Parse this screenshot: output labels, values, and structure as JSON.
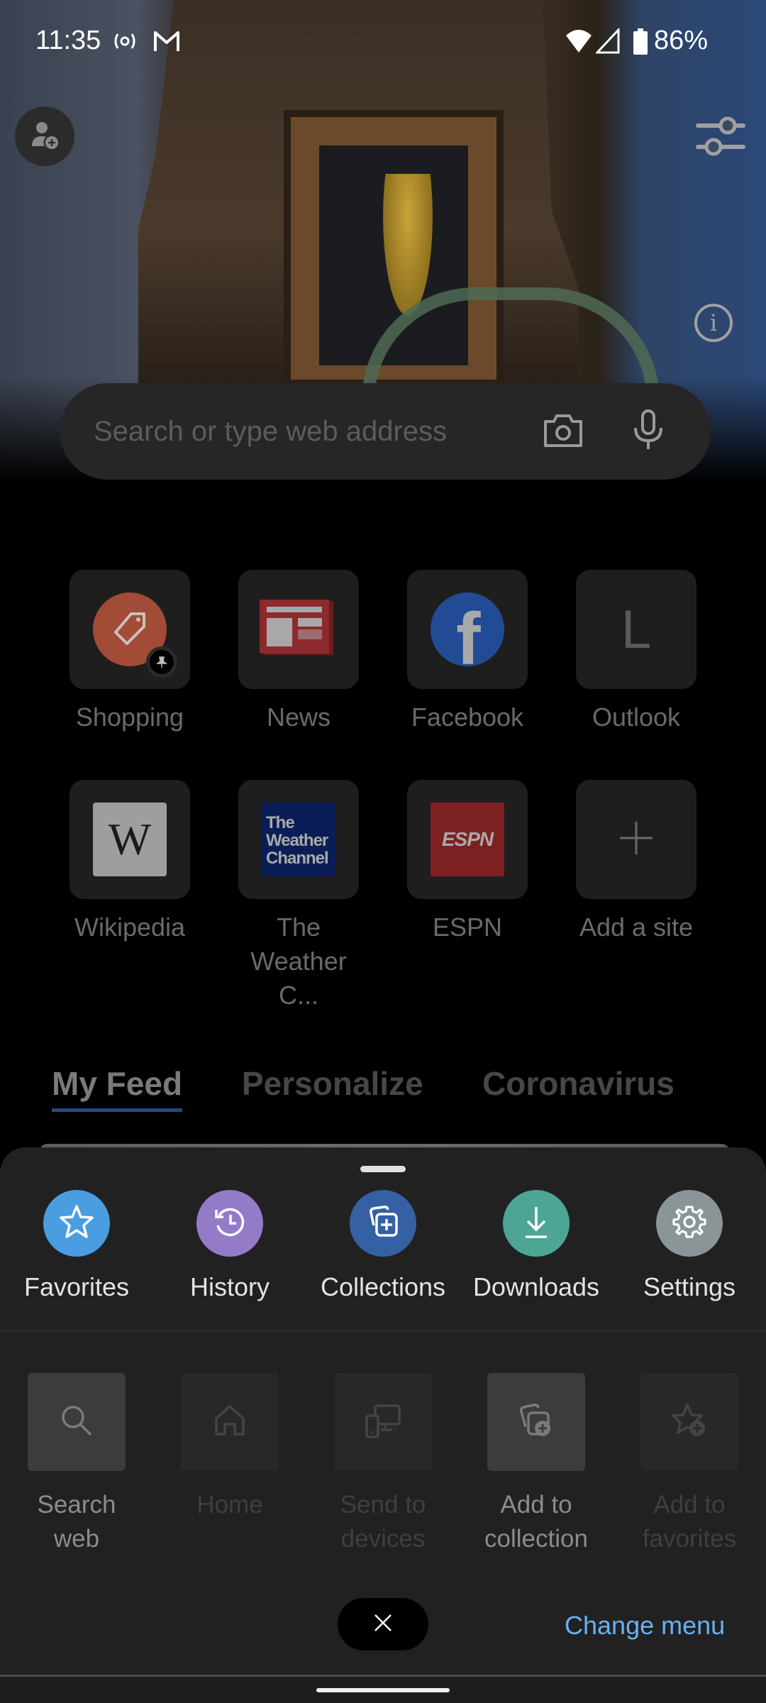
{
  "status_bar": {
    "time": "11:35",
    "icons": [
      "hotspot-icon",
      "gmail-icon",
      "wifi-icon",
      "cellular-signal-icon",
      "battery-icon"
    ],
    "battery": "86%"
  },
  "header": {
    "profile_icon": "add-profile-icon",
    "customize_icon": "sliders-icon",
    "info_icon": "info-icon",
    "info_glyph": "i"
  },
  "search": {
    "placeholder": "Search or type web address",
    "camera_icon": "camera-icon",
    "mic_icon": "microphone-icon"
  },
  "top_sites": [
    {
      "label": "Shopping",
      "icon": "shopping-tag-icon",
      "color": "#a24b36",
      "pinned": true
    },
    {
      "label": "News",
      "icon": "news-icon",
      "color": "#8c2a2c"
    },
    {
      "label": "Facebook",
      "icon": "facebook-icon",
      "color": "#214b94",
      "glyph": "f"
    },
    {
      "label": "Outlook",
      "icon": "letter-avatar-icon",
      "glyph": "L"
    },
    {
      "label": "Wikipedia",
      "icon": "wikipedia-icon",
      "glyph": "W",
      "color": "#9e9e9e"
    },
    {
      "label": "The Weather C...",
      "label_line1": "The",
      "label_line2": "Weather C...",
      "icon": "weather-channel-icon",
      "color": "#0b1d57",
      "logo_lines": [
        "The",
        "Weather",
        "Channel"
      ]
    },
    {
      "label": "ESPN",
      "icon": "espn-icon",
      "color": "#7d2022",
      "glyph": "ESPN"
    },
    {
      "label": "Add a site",
      "icon": "plus-icon",
      "glyph": "+"
    }
  ],
  "feed": {
    "tabs": [
      {
        "label": "My Feed",
        "active": true
      },
      {
        "label": "Personalize",
        "active": false
      },
      {
        "label": "Coronavirus",
        "active": false
      }
    ],
    "accent": "#24497e"
  },
  "menu": {
    "primary": [
      {
        "label": "Favorites",
        "icon": "star-icon",
        "color": "#4a9de0"
      },
      {
        "label": "History",
        "icon": "history-icon",
        "color": "#937bc8"
      },
      {
        "label": "Collections",
        "icon": "collections-icon",
        "color": "#3561a4"
      },
      {
        "label": "Downloads",
        "icon": "download-icon",
        "color": "#4ca595"
      },
      {
        "label": "Settings",
        "icon": "gear-icon",
        "color": "#8a9597"
      }
    ],
    "secondary": [
      {
        "label_line1": "Search",
        "label_line2": "web",
        "icon": "search-icon",
        "enabled": true
      },
      {
        "label_line1": "Home",
        "label_line2": "",
        "icon": "home-icon",
        "enabled": false
      },
      {
        "label_line1": "Send to",
        "label_line2": "devices",
        "icon": "send-to-devices-icon",
        "enabled": false
      },
      {
        "label_line1": "Add to",
        "label_line2": "collection",
        "icon": "add-to-collection-icon",
        "enabled": true
      },
      {
        "label_line1": "Add to",
        "label_line2": "favorites",
        "icon": "add-to-favorites-icon",
        "enabled": false
      }
    ],
    "close_icon": "close-icon",
    "change_menu_label": "Change menu",
    "link_color": "#6ab1f0"
  }
}
